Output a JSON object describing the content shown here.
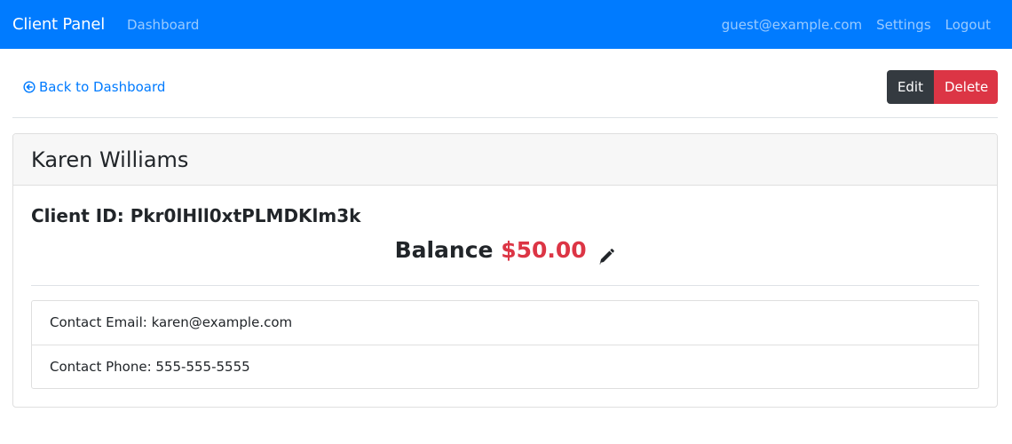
{
  "navbar": {
    "brand": "Client Panel",
    "dashboard_link": "Dashboard",
    "user_email": "guest@example.com",
    "settings_link": "Settings",
    "logout_link": "Logout",
    "bg_color": "#007bff"
  },
  "actions": {
    "back_label": "Back to Dashboard",
    "back_icon": "arrow-circle-left-icon",
    "edit_label": "Edit",
    "delete_label": "Delete"
  },
  "client": {
    "name": "Karen Williams",
    "id_label": "Client ID: Pkr0lHll0xtPLMDKlm3k",
    "balance_label": "Balance",
    "balance_amount": "$50.00",
    "balance_color": "#dc3545",
    "edit_balance_icon": "pencil-icon",
    "contact_email": "Contact Email: karen@example.com",
    "contact_phone": "Contact Phone: 555-555-5555"
  }
}
